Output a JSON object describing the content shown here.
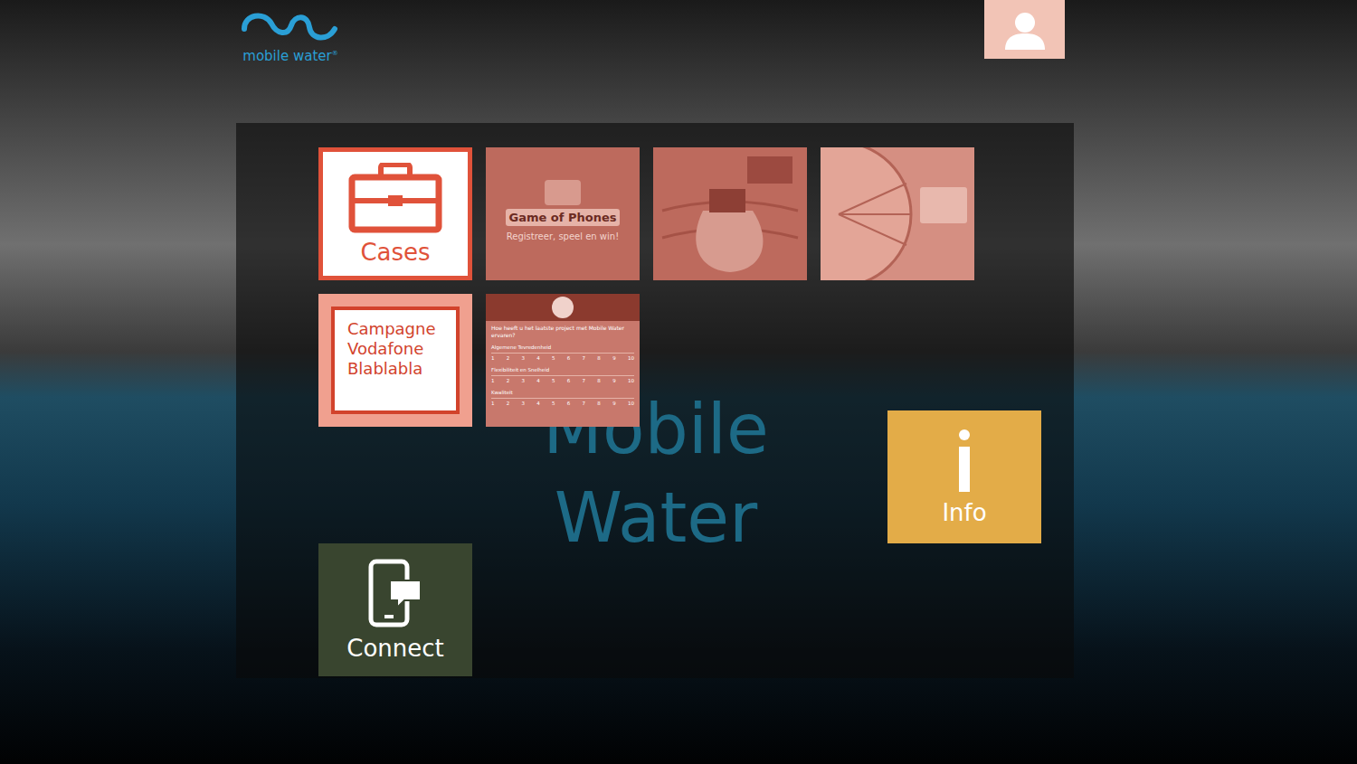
{
  "logo": {
    "text": "mobile water",
    "mark": "®"
  },
  "user": {
    "label": ""
  },
  "watermark": [
    "Mobile",
    "Water"
  ],
  "tiles": [
    {
      "kind": "cases",
      "label": "Cases"
    },
    {
      "kind": "game",
      "title": "Game of Phones",
      "subtitle": "Registreer, speel en win!"
    },
    {
      "kind": "sack"
    },
    {
      "kind": "wheel"
    },
    {
      "kind": "campaign",
      "label": "Campagne Vodafone Blablabla"
    },
    {
      "kind": "survey",
      "question": "Hoe heeft u het laatste project met Mobile Water ervaren?",
      "rows": [
        "Algemene Tevredenheid",
        "Flexibiliteit en Snelheid",
        "Kwaliteit"
      ],
      "scale": [
        "1",
        "2",
        "3",
        "4",
        "5",
        "6",
        "7",
        "8",
        "9",
        "10"
      ]
    }
  ],
  "info": {
    "label": "Info"
  },
  "connect": {
    "label": "Connect"
  }
}
